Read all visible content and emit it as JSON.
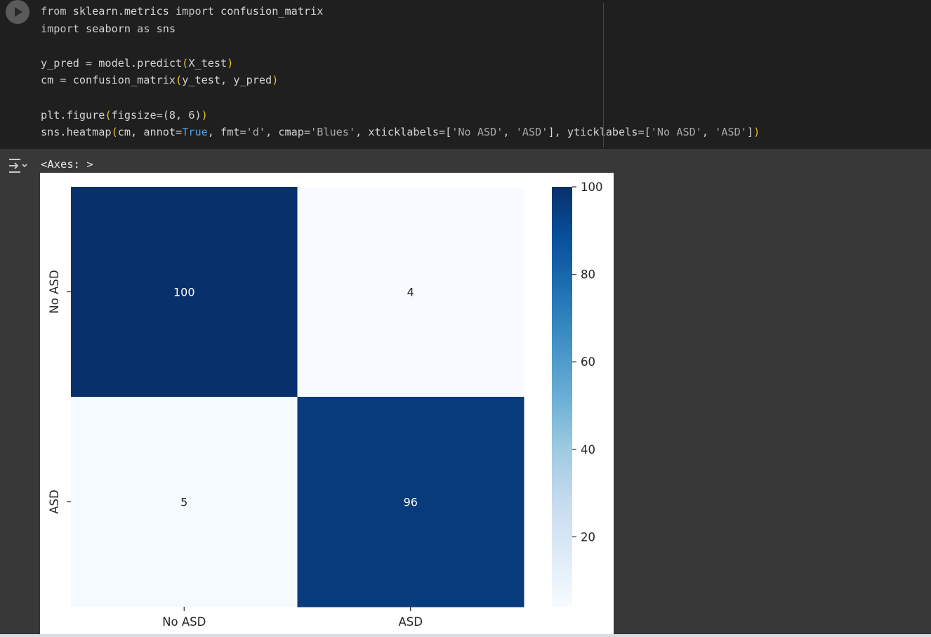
{
  "code": {
    "lines": [
      [
        {
          "t": "from ",
          "c": "kw"
        },
        {
          "t": "sklearn.metrics "
        },
        {
          "t": "import ",
          "c": "kw"
        },
        {
          "t": "confusion_matrix"
        }
      ],
      [
        {
          "t": "import ",
          "c": "kw"
        },
        {
          "t": "seaborn "
        },
        {
          "t": "as ",
          "c": "kw"
        },
        {
          "t": "sns"
        }
      ],
      [],
      [
        {
          "t": "y_pred = model.predict"
        },
        {
          "t": "(",
          "c": "paren"
        },
        {
          "t": "X_test"
        },
        {
          "t": ")",
          "c": "paren"
        }
      ],
      [
        {
          "t": "cm = confusion_matrix"
        },
        {
          "t": "(",
          "c": "paren"
        },
        {
          "t": "y_test, y_pred"
        },
        {
          "t": ")",
          "c": "paren"
        }
      ],
      [],
      [
        {
          "t": "plt.figure"
        },
        {
          "t": "(",
          "c": "paren"
        },
        {
          "t": "figsize=(8, 6)"
        },
        {
          "t": ")",
          "c": "paren"
        }
      ],
      [
        {
          "t": "sns.heatmap"
        },
        {
          "t": "(",
          "c": "paren"
        },
        {
          "t": "cm, annot="
        },
        {
          "t": "True",
          "c": "bool"
        },
        {
          "t": ", fmt="
        },
        {
          "t": "'d'",
          "c": "str"
        },
        {
          "t": ", cmap="
        },
        {
          "t": "'Blues'",
          "c": "str"
        },
        {
          "t": ", xticklabels=["
        },
        {
          "t": "'No ASD'",
          "c": "str"
        },
        {
          "t": ", "
        },
        {
          "t": "'ASD'",
          "c": "str"
        },
        {
          "t": "], yticklabels=["
        },
        {
          "t": "'No ASD'",
          "c": "str"
        },
        {
          "t": ", "
        },
        {
          "t": "'ASD'",
          "c": "str"
        },
        {
          "t": "]"
        },
        {
          "t": ")",
          "c": "paren"
        }
      ]
    ]
  },
  "output": {
    "repr": "<Axes: >"
  },
  "icons": {
    "run": "play-icon",
    "output_toggle": "output-toggle-icon"
  },
  "colors": {
    "editor_bg": "#1f1f1f",
    "output_bg": "#383838",
    "cmap_low": "#f7fbff",
    "cmap_high": "#08306b"
  },
  "chart_data": {
    "type": "heatmap",
    "x_tick_labels": [
      "No ASD",
      "ASD"
    ],
    "y_tick_labels": [
      "No ASD",
      "ASD"
    ],
    "values": [
      [
        100,
        4
      ],
      [
        5,
        96
      ]
    ],
    "annot": true,
    "cmap": "Blues",
    "colorbar": {
      "range": [
        4,
        100
      ],
      "ticks": [
        20,
        40,
        60,
        80,
        100
      ]
    },
    "title": "",
    "xlabel": "",
    "ylabel": ""
  }
}
